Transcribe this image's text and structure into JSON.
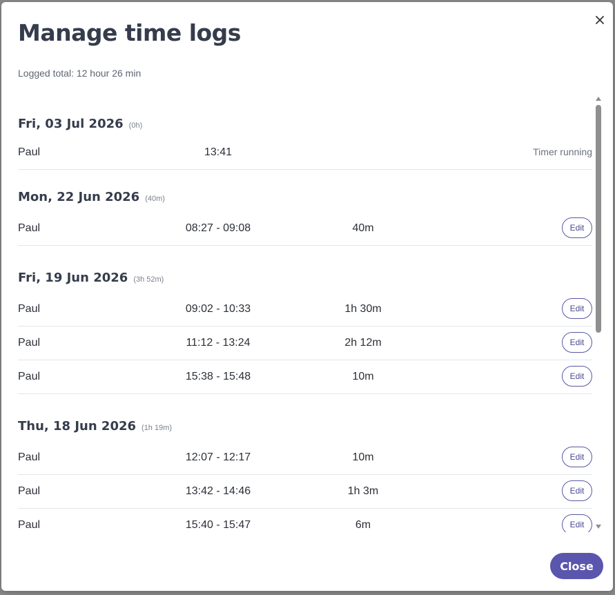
{
  "dialog": {
    "title": "Manage time logs",
    "logged_total": "Logged total: 12 hour 26 min",
    "close_button_label": "Close"
  },
  "days": [
    {
      "date": "Fri, 03 Jul 2026",
      "duration": "(0h)",
      "entries": [
        {
          "user": "Paul",
          "range": "13:41",
          "duration": "",
          "status": "Timer running"
        }
      ]
    },
    {
      "date": "Mon, 22 Jun 2026",
      "duration": "(40m)",
      "entries": [
        {
          "user": "Paul",
          "range": "08:27 - 09:08",
          "duration": "40m",
          "action": "Edit"
        }
      ]
    },
    {
      "date": "Fri, 19 Jun 2026",
      "duration": "(3h 52m)",
      "entries": [
        {
          "user": "Paul",
          "range": "09:02 - 10:33",
          "duration": "1h 30m",
          "action": "Edit"
        },
        {
          "user": "Paul",
          "range": "11:12 - 13:24",
          "duration": "2h 12m",
          "action": "Edit"
        },
        {
          "user": "Paul",
          "range": "15:38 - 15:48",
          "duration": "10m",
          "action": "Edit"
        }
      ]
    },
    {
      "date": "Thu, 18 Jun 2026",
      "duration": "(1h 19m)",
      "entries": [
        {
          "user": "Paul",
          "range": "12:07 - 12:17",
          "duration": "10m",
          "action": "Edit"
        },
        {
          "user": "Paul",
          "range": "13:42 - 14:46",
          "duration": "1h 3m",
          "action": "Edit"
        },
        {
          "user": "Paul",
          "range": "15:40 - 15:47",
          "duration": "6m",
          "action": "Edit"
        }
      ]
    }
  ],
  "colors": {
    "accent": "#5a55ad",
    "heading": "#353c4b",
    "divider": "#e3e5e8"
  }
}
